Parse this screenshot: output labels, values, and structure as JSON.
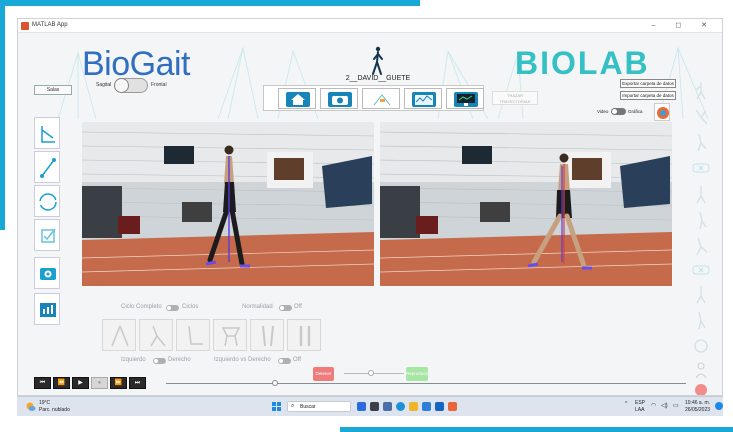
{
  "window": {
    "title": "MATLAB App",
    "controls": "–  ◻  ✕"
  },
  "header": {
    "logo_bio": "Bio",
    "logo_gait": "Gait",
    "lab_logo": "BIOLAB",
    "patient_name": "2__DAVID__GUETE"
  },
  "left_controls": {
    "salas_label": "Salas",
    "sagital_label": "Sagital",
    "frontal_label": "Frontal"
  },
  "nav": {
    "items": [
      "home",
      "camera",
      "skeleton",
      "graph",
      "monitor"
    ]
  },
  "right_controls": {
    "trazar_label": "TRAZAR TRAYECTORIAS",
    "exportar_label": "Exportar carpeta de datos",
    "importar_label": "Importar carpeta de datos",
    "video_label": "Video",
    "grafica_label": "Gráfica"
  },
  "analysis": {
    "ciclo_completo": "Ciclo Completo",
    "ciclos": "Ciclos",
    "normalidad": "Normalidad",
    "off": "Off",
    "izquierdo": "Izquierdo",
    "derecho": "Derecho",
    "izq_vs_der": "Izquierdo vs Derecho",
    "off2": "Off"
  },
  "playback": {
    "detener_label": "Detener",
    "reproducir_label": "Reproducir",
    "buttons": [
      "⏮",
      "⏪",
      "▶",
      "⏸",
      "⏩",
      "⏭"
    ],
    "timeline_progress": 0.21
  },
  "taskbar": {
    "weather_temp": "19°C",
    "weather_desc": "Parc. nublado",
    "search_placeholder": "Buscar",
    "lang": "ESP",
    "lang2": "LAA",
    "time": "10:46 a. m.",
    "date": "26/05/2023"
  },
  "colors": {
    "accent": "#18a9d6",
    "brand_blue": "#2f6ec1",
    "brand_teal": "#35c0c5",
    "stop": "#f07b7b",
    "play": "#a7e6a4"
  }
}
